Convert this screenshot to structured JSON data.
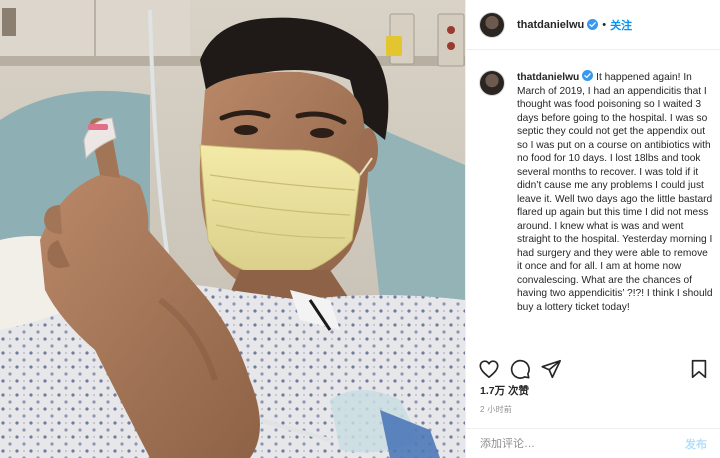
{
  "post": {
    "username": "thatdanielwu",
    "follow_label": "关注",
    "separator": "•",
    "caption": "It happened again! In March of 2019, I had an appendicitis that I thought was food poisoning so I waited 3 days before going to the hospital. I was so septic they could not get the appendix out so I was put on a course on antibiotics with no food for 10 days. I lost 18lbs and took several months to recover. I was told if it didn’t cause me any problems I could just leave it. Well two days ago the little bastard flared up again but this time I did not mess around. I knew what is was and went straight to the hospital. Yesterday morning I had surgery and they were able to remove it once and for all. I am at home now convalescing. What are the chances of having two appendicitis’ ?!?! I think I should buy a lottery ticket today!",
    "likes": "1.7万 次赞",
    "time": "2 小时前",
    "comment_placeholder": "添加评论…",
    "post_label": "发布"
  },
  "icons": {
    "like": "heart-icon",
    "comment": "comment-icon",
    "share": "share-icon",
    "save": "bookmark-icon",
    "verified": "verified-badge-icon"
  },
  "colors": {
    "link_blue": "#0095f6",
    "verified_blue": "#3897f0",
    "post_disabled": "#b2dffc"
  }
}
